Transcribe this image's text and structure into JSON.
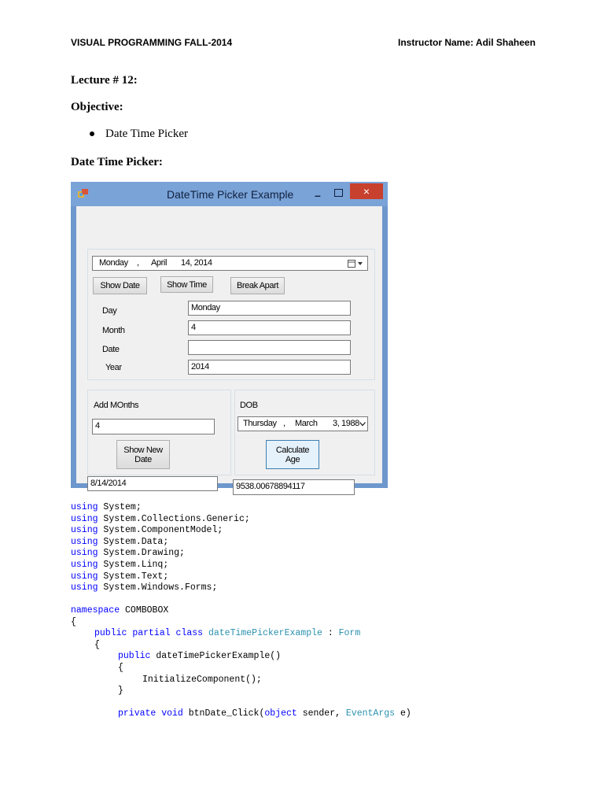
{
  "header": {
    "left": "VISUAL PROGRAMMING FALL-2014",
    "right": "Instructor Name: Adil Shaheen"
  },
  "lecture": "Lecture # 12:",
  "objective_heading": "Objective:",
  "objective_items": [
    "Date Time Picker"
  ],
  "section_heading": "Date Time Picker:",
  "form": {
    "title": "DateTime Picker Example",
    "close_glyph": "×",
    "minimize_glyph": "–",
    "date_picker": {
      "weekday": "Monday",
      "sep": ",",
      "month": "April",
      "date": "14, 2014"
    },
    "show_date_button": "Show Date",
    "show_time_button": "Show Time",
    "break_apart_button": "Break Apart",
    "day_label": "Day",
    "day_value": "Monday",
    "month_label": "Month",
    "month_value": "4",
    "date_label": "Date",
    "date_value": "",
    "year_label": "Year",
    "year_value": "2014",
    "add_months_label": "Add MOnths",
    "add_months_value": "4",
    "show_new_date_button_l1": "Show New",
    "show_new_date_button_l2": "Date",
    "new_date_value": "8/14/2014",
    "dob_label": "DOB",
    "dob_picker": {
      "weekday": "Thursday",
      "sep": ",",
      "month": "March",
      "date": "3, 1988"
    },
    "calculate_age_button_l1": "Calculate",
    "calculate_age_button_l2": "Age",
    "age_value": "9538.00678894117"
  },
  "code": {
    "usings": [
      "System;",
      "System.Collections.Generic;",
      "System.ComponentModel;",
      "System.Data;",
      "System.Drawing;",
      "System.Linq;",
      "System.Text;",
      "System.Windows.Forms;"
    ],
    "kw_using": "using",
    "kw_namespace": "namespace",
    "namespace_name": "COMBOBOX",
    "open_brace": "{",
    "close_brace": "}",
    "kw_public": "public",
    "kw_partial": "partial",
    "kw_class": "class",
    "class_name": "dateTimePickerExample",
    "colon": ":",
    "base_class": "Form",
    "ctor_sig": "dateTimePickerExample()",
    "init_call": "InitializeComponent();",
    "kw_private": "private",
    "kw_void": "void",
    "method_name": "btnDate_Click(",
    "kw_object": "object",
    "param_sender": "sender,",
    "event_args": "EventArgs",
    "param_e": "e)"
  },
  "colors": {
    "window_frame": "#6d97cd",
    "close": "#c8402e",
    "keyword": "#0000ff",
    "type": "#2b91af"
  }
}
